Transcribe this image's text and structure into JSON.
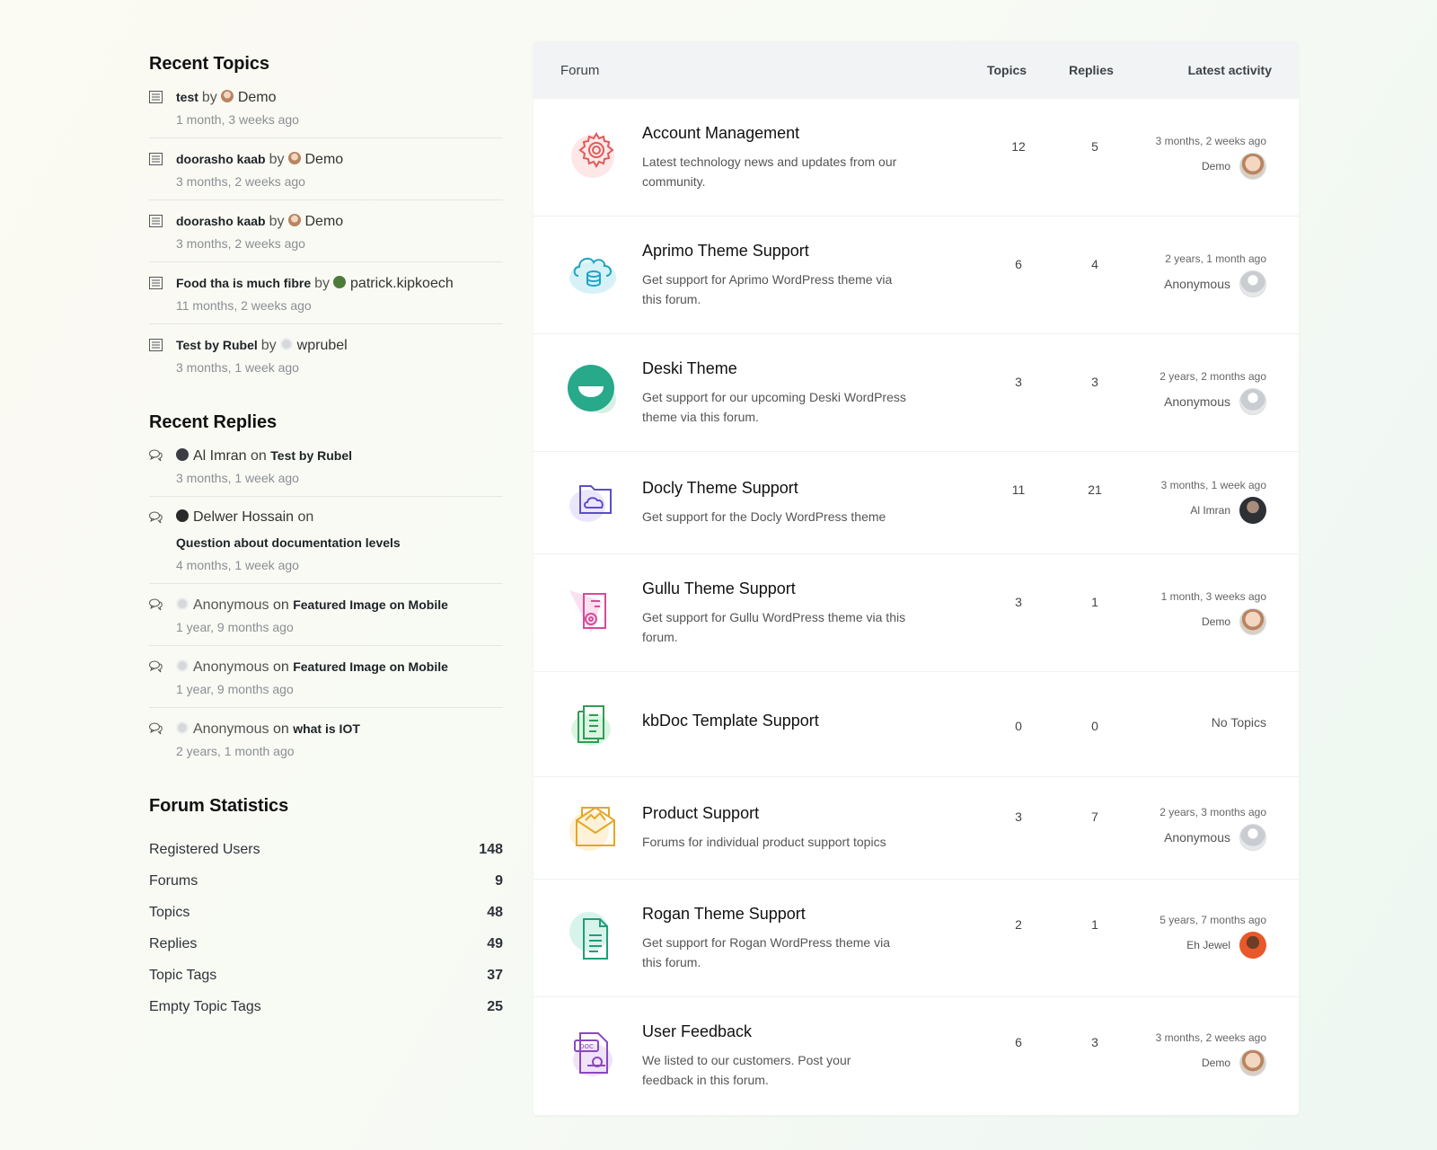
{
  "recent_topics": {
    "title": "Recent Topics",
    "items": [
      {
        "topic": "test",
        "by": "by",
        "author": "Demo",
        "time": "1 month, 3 weeks ago"
      },
      {
        "topic": "doorasho kaab",
        "by": "by",
        "author": "Demo",
        "time": "3 months, 2 weeks ago"
      },
      {
        "topic": "doorasho kaab",
        "by": "by",
        "author": "Demo",
        "time": "3 months, 2 weeks ago"
      },
      {
        "topic": "Food tha is much fibre",
        "by": "by",
        "author": "patrick.kipkoech",
        "time": "11 months, 2 weeks ago"
      },
      {
        "topic": "Test by Rubel",
        "by": "by",
        "author": "wprubel",
        "time": "3 months, 1 week ago"
      }
    ]
  },
  "recent_replies": {
    "title": "Recent Replies",
    "items": [
      {
        "author": "Al Imran",
        "on": "on",
        "topic": "Test by Rubel",
        "time": "3 months, 1 week ago"
      },
      {
        "author": "Delwer Hossain",
        "on": "on",
        "topic": "Question about documentation levels",
        "time": "4 months, 1 week ago"
      },
      {
        "author": "Anonymous",
        "on": "on",
        "topic": "Featured Image on Mobile",
        "time": "1 year, 9 months ago"
      },
      {
        "author": "Anonymous",
        "on": "on",
        "topic": "Featured Image on Mobile",
        "time": "1 year, 9 months ago"
      },
      {
        "author": "Anonymous",
        "on": "on",
        "topic": "what is IOT",
        "time": "2 years, 1 month ago"
      }
    ]
  },
  "forum_statistics": {
    "title": "Forum Statistics",
    "rows": [
      {
        "label": "Registered Users",
        "value": "148"
      },
      {
        "label": "Forums",
        "value": "9"
      },
      {
        "label": "Topics",
        "value": "48"
      },
      {
        "label": "Replies",
        "value": "49"
      },
      {
        "label": "Topic Tags",
        "value": "37"
      },
      {
        "label": "Empty Topic Tags",
        "value": "25"
      }
    ]
  },
  "forum_table": {
    "headers": {
      "forum": "Forum",
      "topics": "Topics",
      "replies": "Replies",
      "activity": "Latest activity"
    },
    "rows": [
      {
        "icon": "gear-icon",
        "title": "Account Management",
        "desc": "Latest technology news and updates from our community.",
        "topics": "12",
        "replies": "5",
        "time": "3 months, 2 weeks ago",
        "user": "Demo"
      },
      {
        "icon": "cloud-database-icon",
        "title": "Aprimo Theme Support",
        "desc": "Get support for Aprimo WordPress theme via this forum.",
        "topics": "6",
        "replies": "4",
        "time": "2 years, 1 month ago",
        "user": "Anonymous"
      },
      {
        "icon": "smile-circle-icon",
        "title": "Deski Theme",
        "desc": "Get support for our upcoming Deski WordPress theme via this forum.",
        "topics": "3",
        "replies": "3",
        "time": "2 years, 2 months ago",
        "user": "Anonymous"
      },
      {
        "icon": "cloud-folder-icon",
        "title": "Docly Theme Support",
        "desc": "Get support for the Docly WordPress theme",
        "topics": "11",
        "replies": "21",
        "time": "3 months, 1 week ago",
        "user": "Al Imran"
      },
      {
        "icon": "document-gear-icon",
        "title": "Gullu Theme Support",
        "desc": "Get support for Gullu WordPress theme via this forum.",
        "topics": "3",
        "replies": "1",
        "time": "1 month, 3 weeks ago",
        "user": "Demo"
      },
      {
        "icon": "documents-icon",
        "title": "kbDoc Template Support",
        "desc": "",
        "topics": "0",
        "replies": "0",
        "time": "",
        "user": "",
        "no_topics": "No Topics"
      },
      {
        "icon": "envelope-image-icon",
        "title": "Product Support",
        "desc": "Forums for individual product support topics",
        "topics": "3",
        "replies": "7",
        "time": "2 years, 3 months ago",
        "user": "Anonymous"
      },
      {
        "icon": "document-lines-icon",
        "title": "Rogan Theme Support",
        "desc": "Get support for Rogan WordPress theme via this forum.",
        "topics": "2",
        "replies": "1",
        "time": "5 years, 7 months ago",
        "user": "Eh Jewel"
      },
      {
        "icon": "doc-file-icon",
        "doc_label": "DOC",
        "title": "User Feedback",
        "desc": "We listed to our customers. Post your feedback in this forum.",
        "topics": "6",
        "replies": "3",
        "time": "3 months, 2 weeks ago",
        "user": "Demo"
      }
    ]
  }
}
